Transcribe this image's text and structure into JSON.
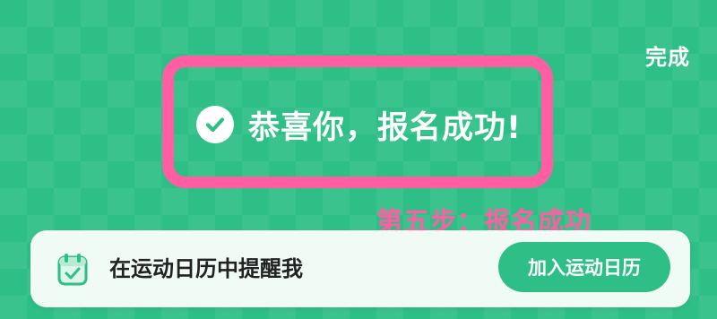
{
  "header": {
    "done_label": "完成"
  },
  "success": {
    "icon": "check-circle-icon",
    "message": "恭喜你，报名成功!"
  },
  "annotation": {
    "step_label": "第五步：报名成功"
  },
  "calendar_card": {
    "icon": "calendar-check-icon",
    "text": "在运动日历中提醒我",
    "button_label": "加入运动日历"
  },
  "colors": {
    "background": "#2ebf86",
    "highlight_border": "#ff5fa2",
    "annotation_text": "#ff5fa2",
    "card_background": "#f0fbf6",
    "button_background": "#2ebf86"
  }
}
